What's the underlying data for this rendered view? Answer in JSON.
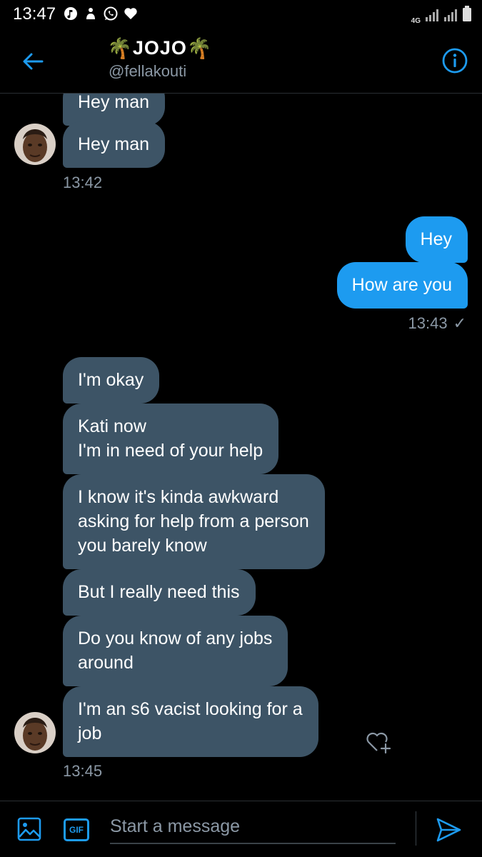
{
  "status_bar": {
    "time": "13:47",
    "network": "4G",
    "icons_left": [
      "music-icon",
      "app-icon",
      "whatsapp-icon",
      "heart-icon"
    ],
    "icons_right": [
      "signal-icon",
      "signal-icon",
      "battery-icon"
    ]
  },
  "header": {
    "name": "JOJO",
    "name_decoration": "🌴",
    "handle": "@fellakouti"
  },
  "messages": [
    {
      "from": "them",
      "text": "Hey man"
    },
    {
      "from": "them",
      "text": "Hey man"
    },
    {
      "from": "them",
      "stamp": "13:42"
    },
    {
      "from": "me",
      "text": "Hey"
    },
    {
      "from": "me",
      "text": "How are you"
    },
    {
      "from": "me",
      "stamp": "13:43",
      "read": "✓"
    },
    {
      "from": "them",
      "text": "I'm okay"
    },
    {
      "from": "them",
      "text": "Kati now\nI'm in need of your help"
    },
    {
      "from": "them",
      "text": "I know it's kinda awkward\nasking for help from a person\nyou barely know"
    },
    {
      "from": "them",
      "text": "But I really need this"
    },
    {
      "from": "them",
      "text": "Do you know of any jobs\naround"
    },
    {
      "from": "them",
      "text": "I'm an s6 vacist looking for a\njob"
    },
    {
      "from": "them",
      "stamp": "13:45"
    }
  ],
  "composer": {
    "placeholder": "Start a message",
    "gif_label": "GIF"
  },
  "colors": {
    "accent": "#1d9bf0",
    "incoming_bubble": "#3d5466",
    "background": "#000000",
    "muted_text": "#8b98a5"
  }
}
